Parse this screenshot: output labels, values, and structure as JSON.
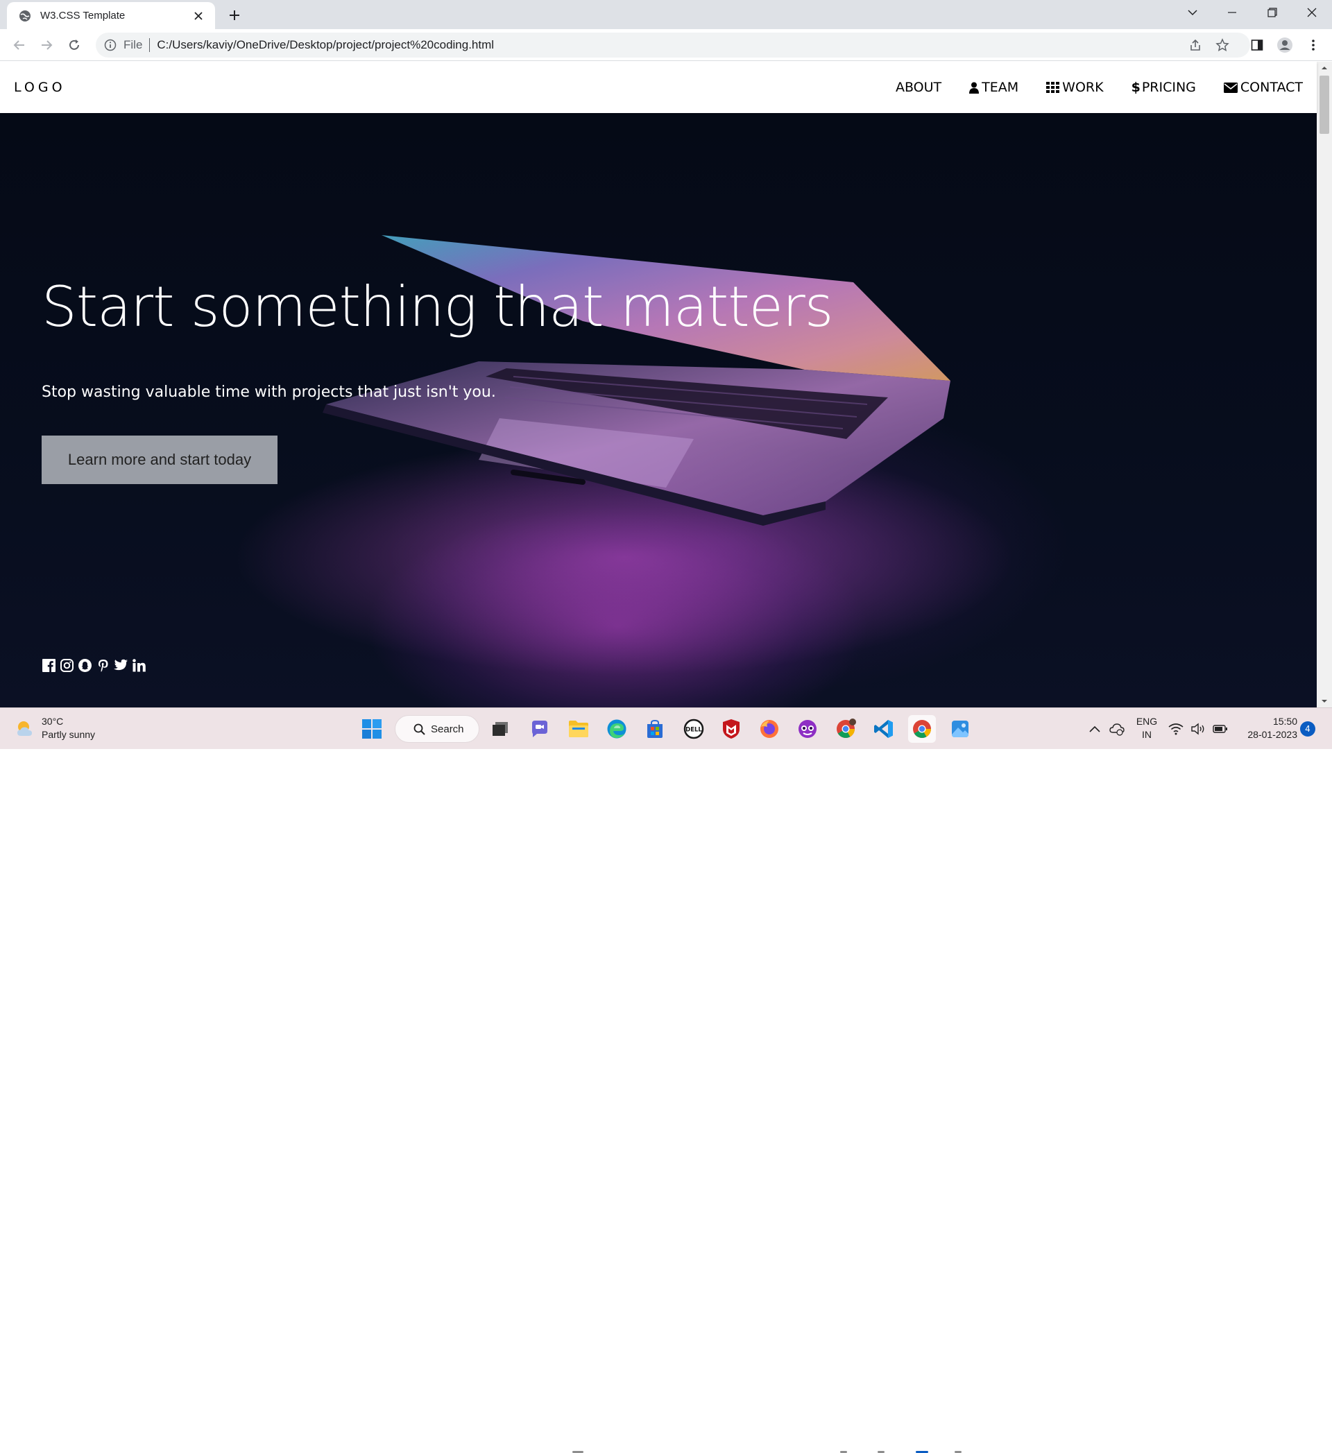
{
  "browser": {
    "tab_title": "W3.CSS Template",
    "url_scheme": "File",
    "url": "C:/Users/kaviy/OneDrive/Desktop/project/project%20coding.html"
  },
  "site": {
    "logo": "LOGO",
    "nav": [
      {
        "label": "ABOUT",
        "icon": "none"
      },
      {
        "label": "TEAM",
        "icon": "user-icon"
      },
      {
        "label": "WORK",
        "icon": "grid-icon"
      },
      {
        "label": "PRICING",
        "icon": "dollar-icon"
      },
      {
        "label": "CONTACT",
        "icon": "envelope-icon"
      }
    ],
    "hero": {
      "title": "Start something that matters",
      "subtitle": "Stop wasting valuable time with projects that just isn't you.",
      "button": "Learn more and start today"
    },
    "social_icons": [
      "facebook-icon",
      "instagram-icon",
      "snapchat-icon",
      "pinterest-icon",
      "twitter-icon",
      "linkedin-icon"
    ]
  },
  "taskbar": {
    "weather_temp": "30°C",
    "weather_desc": "Partly sunny",
    "search_label": "Search",
    "language_top": "ENG",
    "language_bottom": "IN",
    "time": "15:50",
    "date": "28-01-2023",
    "notification_count": "4"
  },
  "colors": {
    "hero_button_bg": "#9a9ea6",
    "nav_bg": "#ffffff",
    "taskbar_bg": "#eee3e6"
  }
}
